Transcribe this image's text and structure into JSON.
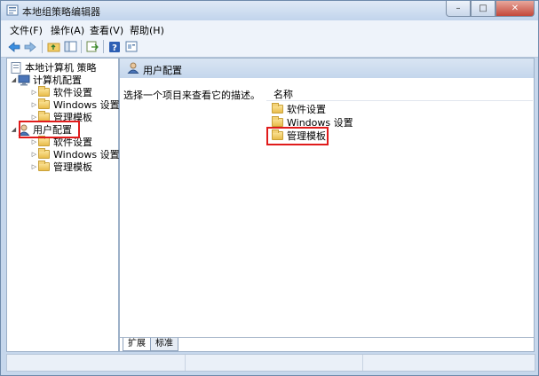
{
  "window": {
    "title": "本地组策略编辑器",
    "controls": {
      "minimize": "–",
      "maximize": "□",
      "close": "✕"
    }
  },
  "menu": {
    "items": [
      "文件(F)",
      "操作(A)",
      "查看(V)",
      "帮助(H)"
    ]
  },
  "toolbar": {
    "icons": [
      "back-arrow-icon",
      "forward-arrow-icon",
      "up-folder-icon",
      "show-hide-tree-icon",
      "export-list-icon",
      "help-icon",
      "properties-icon"
    ]
  },
  "tree": {
    "root": "本地计算机 策略",
    "computer_config": "计算机配置",
    "computer_children": [
      "软件设置",
      "Windows 设置",
      "管理模板"
    ],
    "user_config": "用户配置",
    "user_children": [
      "软件设置",
      "Windows 设置",
      "管理模板"
    ]
  },
  "details": {
    "header": "用户配置",
    "description": "选择一个项目来查看它的描述。",
    "column_name": "名称",
    "items": [
      "软件设置",
      "Windows 设置",
      "管理模板"
    ]
  },
  "tabs": [
    "扩展",
    "标准"
  ],
  "highlight_color": "#e01b1b"
}
